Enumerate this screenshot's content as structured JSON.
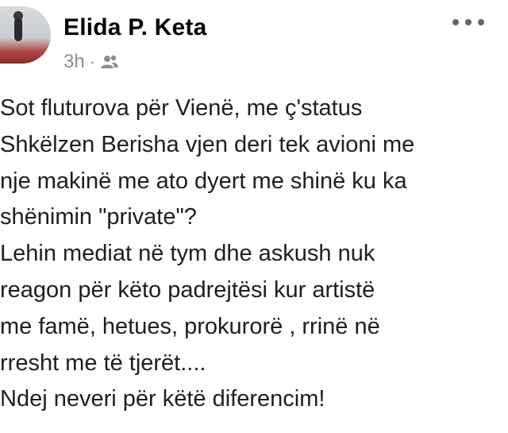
{
  "post": {
    "author": "Elida P. Keta",
    "timestamp": "3h",
    "separator": "·",
    "audience_icon": "friends-icon",
    "more_icon": "more-options-icon",
    "lines": [
      "Sot fluturova për Vienë, me ç'status",
      "Shkëlzen Berisha vjen deri tek avioni me",
      "nje makinë me ato dyert me shinë ku ka",
      "shënimin \"private\"?",
      "Lehin mediat në tym dhe askush nuk",
      "reagon për këto padrejtësi kur artistë",
      "me famë, hetues, prokurorë , rrinë në",
      "rresht me të tjerët....",
      "Ndej neveri për këtë diferencim!"
    ]
  }
}
